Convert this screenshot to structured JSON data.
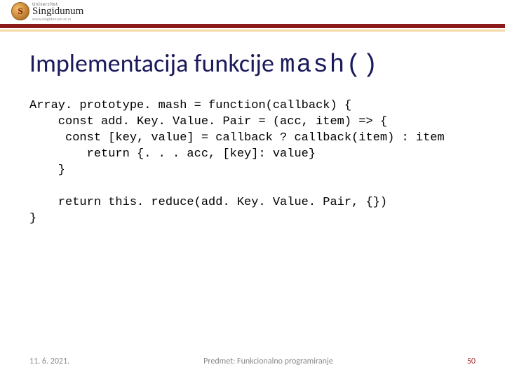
{
  "logo": {
    "mark_letter": "S",
    "univ": "Univerzitet",
    "name": "Singidunum",
    "url": "www.singidunum.ac.rs"
  },
  "title": {
    "prefix": "Implementacija funkcije ",
    "mono": "mash()"
  },
  "code": {
    "l1": "Array. prototype. mash = function(callback) {",
    "l2": "    const add. Key. Value. Pair = (acc, item) => {",
    "l3": "     const [key, value] = callback ? callback(item) : item",
    "l4": "        return {. . . acc, [key]: value}",
    "l5": "    }",
    "l6": "",
    "l7": "    return this. reduce(add. Key. Value. Pair, {})",
    "l8": "}"
  },
  "footer": {
    "date": "11. 6. 2021.",
    "subject": "Predmet: Funkcionalno programiranje",
    "pagenum": "50"
  }
}
